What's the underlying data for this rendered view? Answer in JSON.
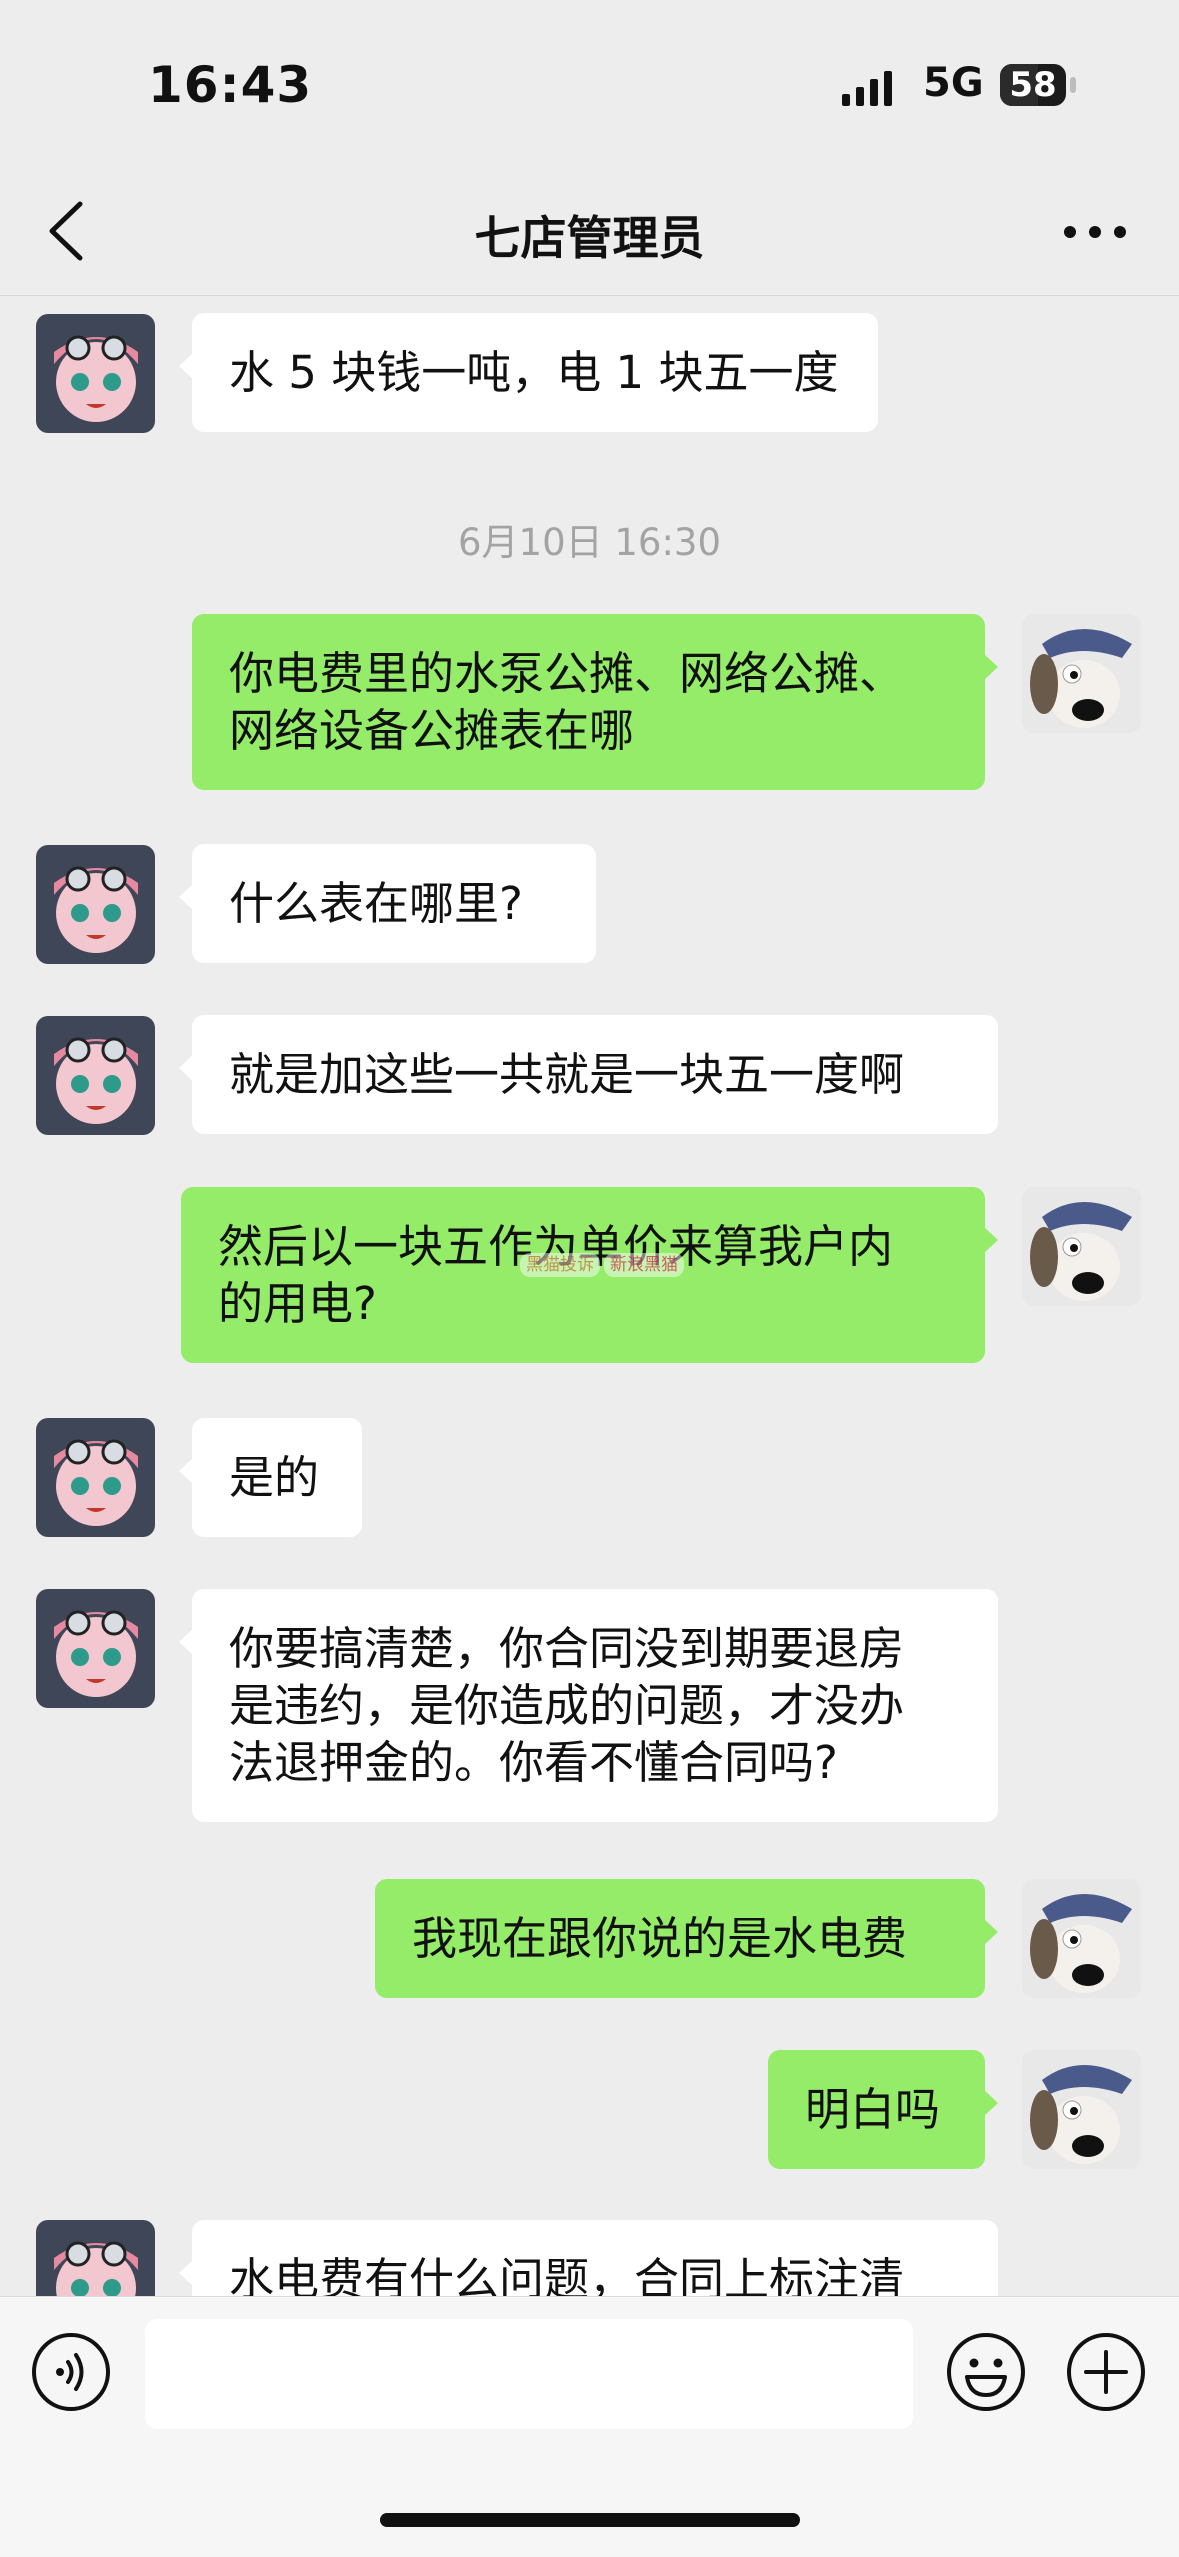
{
  "status_bar": {
    "time": "16:43",
    "network": "5G",
    "battery": "58",
    "battery_level": 0.58
  },
  "header": {
    "title": "七店管理员",
    "back_icon": "chevron-left-icon",
    "more_icon": "more-dots-icon"
  },
  "timestamp": "6月10日 16:30",
  "messages": [
    {
      "from": "them",
      "lines": [
        "水 5 块钱一吨，电 1 块五一度"
      ]
    },
    {
      "from": "me",
      "lines": [
        "你电费里的水泵公摊、网络公摊、",
        "网络设备公摊表在哪"
      ]
    },
    {
      "from": "them",
      "lines": [
        "什么表在哪里?"
      ]
    },
    {
      "from": "them",
      "lines": [
        "就是加这些一共就是一块五一度啊"
      ]
    },
    {
      "from": "me",
      "lines": [
        "然后以一块五作为单价来算我户内",
        "的用电?"
      ]
    },
    {
      "from": "them",
      "lines": [
        "是的"
      ]
    },
    {
      "from": "them",
      "lines": [
        "你要搞清楚，你合同没到期要退房",
        "是违约，是你造成的问题，才没办",
        "法退押金的。你看不懂合同吗?"
      ]
    },
    {
      "from": "me",
      "lines": [
        "我现在跟你说的是水电费"
      ]
    },
    {
      "from": "me",
      "lines": [
        "明白吗"
      ]
    },
    {
      "from": "them",
      "lines": [
        "水电费有什么问题，合同上标注清"
      ]
    }
  ],
  "watermark": {
    "site": "黑猫投诉",
    "brand": "新浪黑猫"
  },
  "input_bar": {
    "voice_icon": "voice-icon",
    "emoji_icon": "emoji-icon",
    "plus_icon": "plus-icon",
    "text": ""
  },
  "colors": {
    "background": "#ededed",
    "bubble_in": "#ffffff",
    "bubble_out": "#95ec69",
    "timestamp": "#a3a3a3"
  }
}
